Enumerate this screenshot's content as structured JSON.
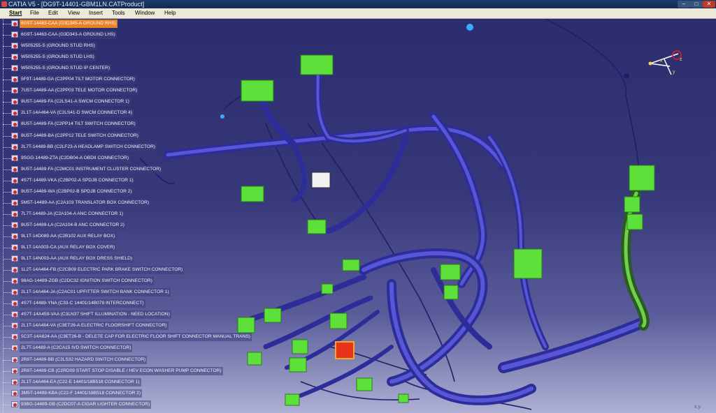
{
  "window": {
    "title": "CATIA V5 - [DG9T-14401-GBM1LN.CATProduct]",
    "minimize": "–",
    "maximize": "□",
    "close": "✕"
  },
  "menu": [
    "Start",
    "File",
    "Edit",
    "View",
    "Insert",
    "Tools",
    "Window",
    "Help"
  ],
  "tree": {
    "selected_index": 0,
    "icon": "connector-part-icon",
    "items": [
      "6G9T-14463-CAA (G3D345-A  GROUND RHS)",
      "6G9T-14463-CAA (G3D343-A  GROUND LHS)",
      "W505255-S (GROUND STUD RHS)",
      "W505255-S (GROUND STUD LHS)",
      "W505255-S (GROUND STUD IP CENTER)",
      "5F9T-14489-GA (C2PP04  TILT MOTOR CONNECTOR)",
      "7U5T-14489-AA (C2PP03  TELE MOTOR CONNECTOR)",
      "9U5T-14489-FA (C2LS41-A  SWCM CONNECTOR 1)",
      "2L1T-14A464-VA (C2LS41-D  SWCM CONNECTOR 4)",
      "8U5T-14489-FA (C2PP14  TILT SWITCH CONNECTOR)",
      "8U5T-14489-BA (C2PP12  TELE SWITCH CONNECTOR)",
      "2L7T-14489-BB (C2LF23-A  HEADLAMP SWITCH CONNECTOR)",
      "9SGG-14489-ZTA (C2DB04-A  OBDII CONNECTOR)",
      "9U5T-14489-FA (C2MC01  INSTRUMENT CLUSTER CONNECTOR)",
      "4S7T-14489-VKA (C2BP02-A  SPDJB CONNECTOR 1)",
      "9U5T-14489-WA (C2BP02-B  SPDJB CONNECTOR 2)",
      "5M5T-14489-AA (C2A103  TRANSLATOR BOX CONNECTOR)",
      "7L7T-14489-JA (C2A104-A  ANC CONNECTOR 1)",
      "8U5T-14489-LA (C2A104-B  ANC CONNECTOR 2)",
      "9L1T-14D089-AA (C2B102  AUX RELAY BOX)",
      "9L1T-14A003-CA (AUX RELAY BOX COVER)",
      "9L1T-14N003-AA (AUX RELAY BOX DRESS SHIELD)",
      "1L2T-14A464-FB (C2CB09  ELECTRIC PARK BRAKE SWITCH CONNECTOR)",
      "98AG-14489-ZGB (C2DC32  IGNITION SWITCH CONNECTOR)",
      "2L1T-14A464-JA (C2AC01  UPFITTER SWITCH BANK CONNECTOR 1)",
      "4S7T-14489-YNA (C33-C  14401/14B079 INTERCONNECT)",
      "4S7T-14A459-VAA (C3LN37 SHIFT ILLUMINATION - NEED LOCATION)",
      "2L1T-14A464-VA (C3ET26-A ELECTRIC FLOORSHIFT CONNECTOR)",
      "5C3T-14A624-AA (C3ET26-B - DELETE CAP FOR ELECTRIC FLOOR SHIFT CONNECTOR MANUAL TRANS)",
      "2L7T-14489-A (C2CA15 IVD SWITCH CONNECTOR)",
      "2R8T-14489-BB (C2LS32 HAZARD SWITCH CONNECTOR)",
      "2R8T-14489-CB (C2RD09 START STOP DISABLE / HEV ECON WASHER PUMP CONNECTOR)",
      "2L1T-14A464-EA (C22-E 14401/18B518 CONNECTOR 1)",
      "3M5T-14489-KBA (C22-F 14401/18B518 CONNECTOR 2)",
      "93BG-14489-GB (C2DC07-A  CIGAR LIGHTER CONNECTOR)"
    ]
  },
  "scene": {
    "model": "wire-harness-3d-model",
    "harness_color": "#3f3fb8",
    "connector_color": "#5ee03a",
    "highlight_color": "#e8341c",
    "compass": {
      "labels": [
        "x",
        "y",
        "z"
      ]
    },
    "corner_label": "x.y"
  }
}
